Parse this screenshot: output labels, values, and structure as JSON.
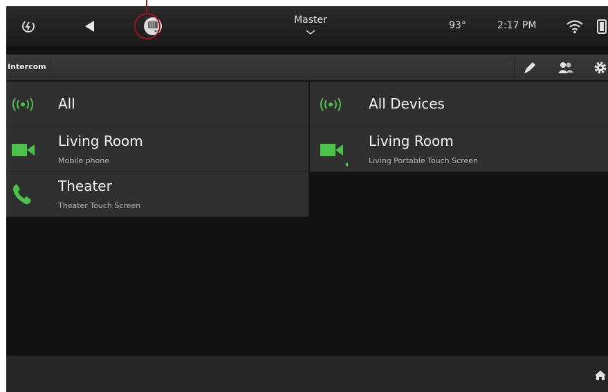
{
  "topbar": {
    "room": "Master",
    "temperature": "93°",
    "time": "2:17 PM"
  },
  "section": {
    "title": "Intercom"
  },
  "left_list": [
    {
      "title": "All",
      "subtitle": "",
      "icon": "broadcast-icon"
    },
    {
      "title": "Living Room",
      "subtitle": "Mobile phone",
      "icon": "video-camera-icon"
    },
    {
      "title": "Theater",
      "subtitle": "Theater Touch Screen",
      "icon": "phone-icon"
    }
  ],
  "right_list": [
    {
      "title": "All Devices",
      "subtitle": "",
      "icon": "broadcast-icon"
    },
    {
      "title": "Living Room",
      "subtitle": "Living Portable Touch Screen",
      "icon": "video-camera-icon"
    }
  ],
  "colors": {
    "accent_green": "#4cc24a",
    "callout_red": "#a0131b",
    "background": "#111111"
  }
}
